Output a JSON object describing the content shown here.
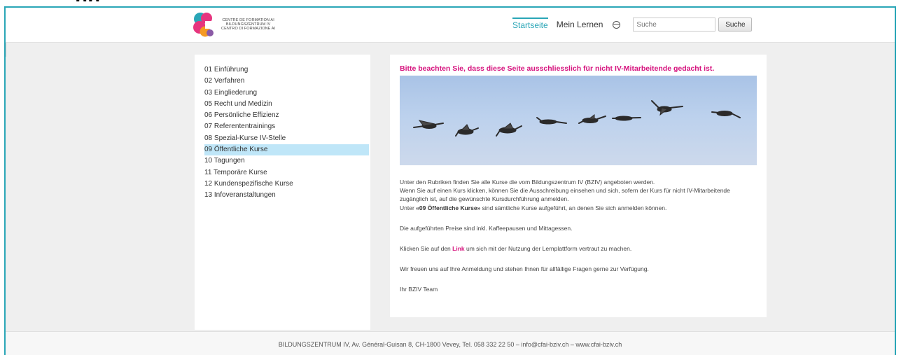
{
  "header": {
    "logo": {
      "line1": "CENTRE DE FORMATION AI",
      "line2": "BILDUNGSZENTRUM IV",
      "line3": "CENTRO DI FORMAZIONE AI",
      "colors": [
        "#e6357f",
        "#2aa6b7",
        "#f59a23",
        "#8b5aa6"
      ]
    },
    "nav": {
      "home": "Startseite",
      "learning": "Mein Lernen"
    },
    "search": {
      "placeholder": "Suche",
      "button": "Suche"
    }
  },
  "sidebar": {
    "items": [
      "01 Einführung",
      "02 Verfahren",
      "03 Eingliederung",
      "05 Recht und Medizin",
      "06 Persönliche Effizienz",
      "07 Referententrainings",
      "08 Spezial-Kurse IV-Stelle",
      "09 Öffentliche Kurse",
      "10 Tagungen",
      "11 Temporäre Kurse",
      "12 Kundenspezifische Kurse",
      "13 Infoveranstaltungen"
    ],
    "active_index": 7
  },
  "main": {
    "notice": "Bitte beachten Sie, dass diese Seite ausschliesslich für nicht IV-Mitarbeitende gedacht ist.",
    "p1_line1": "Unter den Rubriken finden Sie alle Kurse die vom Bildungszentrum IV (BZIV) angeboten werden.",
    "p1_line2": "Wenn Sie auf einen Kurs klicken, können Sie die Ausschreibung einsehen und sich, sofern der Kurs für nicht IV-Mitarbeitende zugänglich ist, auf die gewünschte Kursdurchführung anmelden.",
    "p1_line3_pre": "Unter ",
    "p1_line3_bold": "«09 Öffentliche Kurse»",
    "p1_line3_post": " sind sämtliche Kurse aufgeführt, an denen Sie sich anmelden können.",
    "p2": "Die aufgeführten Preise sind inkl. Kaffeepausen und Mittagessen.",
    "p3_pre": "Klicken Sie auf den ",
    "p3_link": "Link",
    "p3_post": " um sich mit der Nutzung der Lernplattform vertraut zu machen.",
    "p4": "Wir freuen uns auf Ihre Anmeldung und stehen Ihnen für allfällige Fragen gerne zur Verfügung.",
    "p5": "Ihr BZIV Team"
  },
  "footer": {
    "text": "BILDUNGSZENTRUM IV, Av. Général-Guisan 8, CH-1800 Vevey, Tel. 058 332 22 50 – info@cfai-bziv.ch – www.cfai-bziv.ch"
  }
}
